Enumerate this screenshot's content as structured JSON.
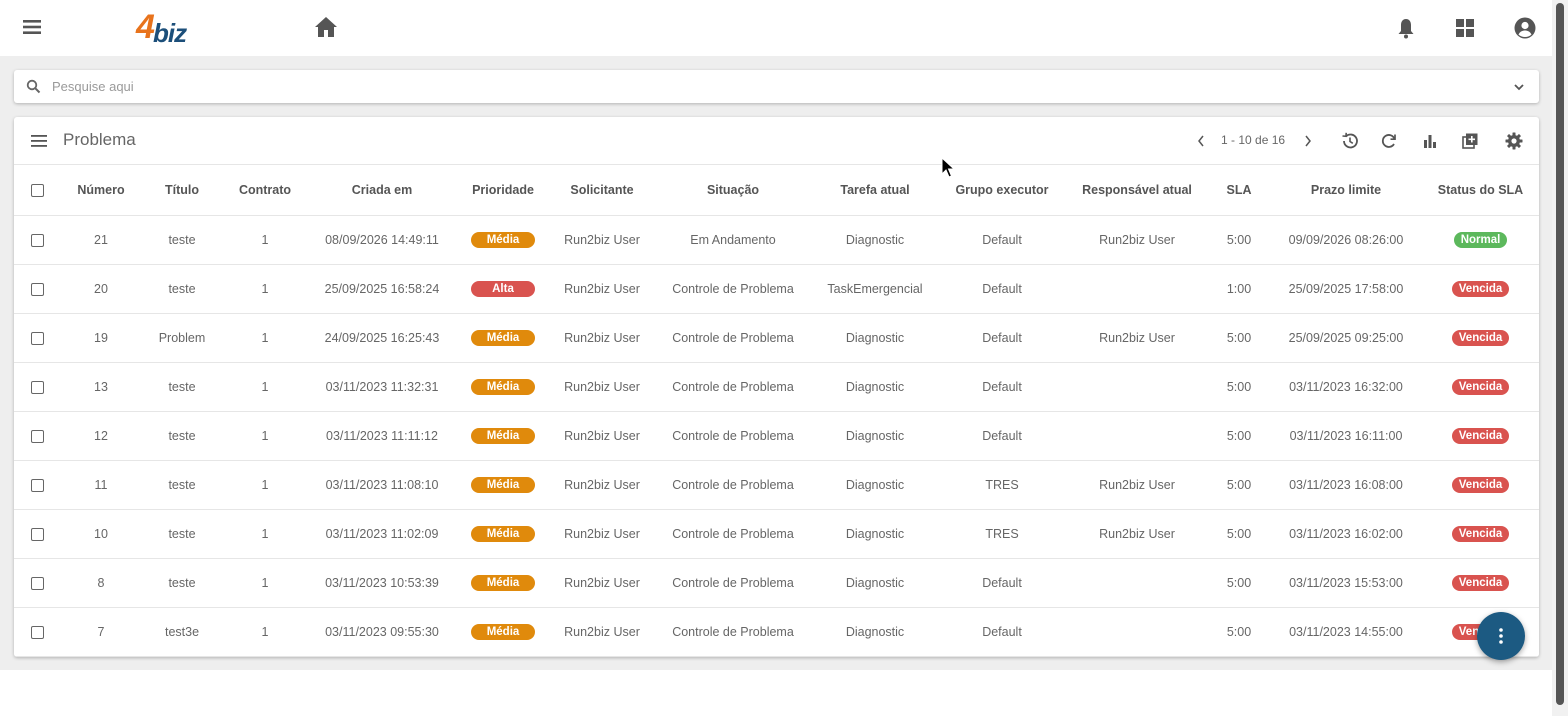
{
  "app": {
    "logo_num": "4",
    "logo_text": "biz"
  },
  "topbar_icons": [
    "menu-icon",
    "home-icon",
    "bell-icon",
    "apps-grid-icon",
    "account-circle-icon"
  ],
  "search": {
    "placeholder": "Pesquise aqui"
  },
  "panel": {
    "title": "Problema",
    "pagination": "1 - 10 de 16"
  },
  "table": {
    "headers": [
      "Número",
      "Título",
      "Contrato",
      "Criada em",
      "Prioridade",
      "Solicitante",
      "Situação",
      "Tarefa atual",
      "Grupo executor",
      "Responsável atual",
      "SLA",
      "Prazo limite",
      "Status do SLA"
    ],
    "rows": [
      {
        "numero": "21",
        "titulo": "teste",
        "contrato": "1",
        "criada": "08/09/2026 14:49:11",
        "prioridade": "Média",
        "solicitante": "Run2biz User",
        "situacao": "Em Andamento",
        "tarefa": "Diagnostic",
        "grupo": "Default",
        "responsavel": "Run2biz User",
        "sla": "5:00",
        "prazo": "09/09/2026 08:26:00",
        "status_sla": "Normal"
      },
      {
        "numero": "20",
        "titulo": "teste",
        "contrato": "1",
        "criada": "25/09/2025 16:58:24",
        "prioridade": "Alta",
        "solicitante": "Run2biz User",
        "situacao": "Controle de Problema",
        "tarefa": "TaskEmergencial",
        "grupo": "Default",
        "responsavel": "",
        "sla": "1:00",
        "prazo": "25/09/2025 17:58:00",
        "status_sla": "Vencida"
      },
      {
        "numero": "19",
        "titulo": "Problem",
        "contrato": "1",
        "criada": "24/09/2025 16:25:43",
        "prioridade": "Média",
        "solicitante": "Run2biz User",
        "situacao": "Controle de Problema",
        "tarefa": "Diagnostic",
        "grupo": "Default",
        "responsavel": "Run2biz User",
        "sla": "5:00",
        "prazo": "25/09/2025 09:25:00",
        "status_sla": "Vencida"
      },
      {
        "numero": "13",
        "titulo": "teste",
        "contrato": "1",
        "criada": "03/11/2023 11:32:31",
        "prioridade": "Média",
        "solicitante": "Run2biz User",
        "situacao": "Controle de Problema",
        "tarefa": "Diagnostic",
        "grupo": "Default",
        "responsavel": "",
        "sla": "5:00",
        "prazo": "03/11/2023 16:32:00",
        "status_sla": "Vencida"
      },
      {
        "numero": "12",
        "titulo": "teste",
        "contrato": "1",
        "criada": "03/11/2023 11:11:12",
        "prioridade": "Média",
        "solicitante": "Run2biz User",
        "situacao": "Controle de Problema",
        "tarefa": "Diagnostic",
        "grupo": "Default",
        "responsavel": "",
        "sla": "5:00",
        "prazo": "03/11/2023 16:11:00",
        "status_sla": "Vencida"
      },
      {
        "numero": "11",
        "titulo": "teste",
        "contrato": "1",
        "criada": "03/11/2023 11:08:10",
        "prioridade": "Média",
        "solicitante": "Run2biz User",
        "situacao": "Controle de Problema",
        "tarefa": "Diagnostic",
        "grupo": "TRES",
        "responsavel": "Run2biz User",
        "sla": "5:00",
        "prazo": "03/11/2023 16:08:00",
        "status_sla": "Vencida"
      },
      {
        "numero": "10",
        "titulo": "teste",
        "contrato": "1",
        "criada": "03/11/2023 11:02:09",
        "prioridade": "Média",
        "solicitante": "Run2biz User",
        "situacao": "Controle de Problema",
        "tarefa": "Diagnostic",
        "grupo": "TRES",
        "responsavel": "Run2biz User",
        "sla": "5:00",
        "prazo": "03/11/2023 16:02:00",
        "status_sla": "Vencida"
      },
      {
        "numero": "8",
        "titulo": "teste",
        "contrato": "1",
        "criada": "03/11/2023 10:53:39",
        "prioridade": "Média",
        "solicitante": "Run2biz User",
        "situacao": "Controle de Problema",
        "tarefa": "Diagnostic",
        "grupo": "Default",
        "responsavel": "",
        "sla": "5:00",
        "prazo": "03/11/2023 15:53:00",
        "status_sla": "Vencida"
      },
      {
        "numero": "7",
        "titulo": "test3e",
        "contrato": "1",
        "criada": "03/11/2023 09:55:30",
        "prioridade": "Média",
        "solicitante": "Run2biz User",
        "situacao": "Controle de Problema",
        "tarefa": "Diagnostic",
        "grupo": "Default",
        "responsavel": "",
        "sla": "5:00",
        "prazo": "03/11/2023 14:55:00",
        "status_sla": "Vencida"
      }
    ]
  },
  "colors": {
    "priority_media": "#e08a0c",
    "priority_alta": "#d9534f",
    "sla_normal": "#5cb85c",
    "sla_vencida": "#d9534f",
    "fab": "#1c5a82",
    "logo_orange": "#e8731c",
    "logo_blue": "#1c4f7a"
  }
}
